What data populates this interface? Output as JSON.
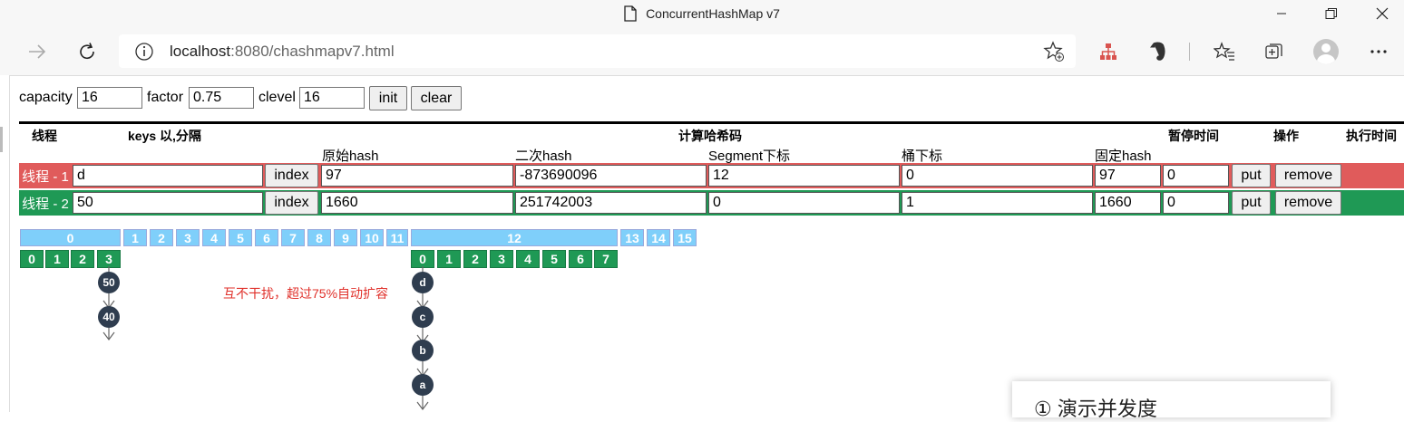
{
  "window": {
    "title": "ConcurrentHashMap v7"
  },
  "address": {
    "host": "localhost",
    "rest": ":8080/chashmapv7.html"
  },
  "form": {
    "capacity_label": "capacity",
    "capacity_value": "16",
    "factor_label": "factor",
    "factor_value": "0.75",
    "clevel_label": "clevel",
    "clevel_value": "16",
    "init_label": "init",
    "clear_label": "clear"
  },
  "table": {
    "headers": {
      "thread": "线程",
      "keys": "keys 以,分隔",
      "compute": "计算哈希码",
      "pause": "暂停时间",
      "ops": "操作",
      "exec": "执行时间"
    },
    "subheaders": {
      "orig_hash": "原始hash",
      "second_hash": "二次hash",
      "segment_index": "Segment下标",
      "bucket_index": "桶下标",
      "fixed_hash": "固定hash"
    },
    "rows": [
      {
        "name": "线程 - 1",
        "keys": "d",
        "index_label": "index",
        "orig_hash": "97",
        "second_hash": "-873690096",
        "segment": "12",
        "bucket": "0",
        "fixed_hash": "97",
        "pause": "0",
        "put_label": "put",
        "remove_label": "remove",
        "color": "#e05b5b"
      },
      {
        "name": "线程 - 2",
        "keys": "50",
        "index_label": "index",
        "orig_hash": "1660",
        "second_hash": "251742003",
        "segment": "0",
        "bucket": "1",
        "fixed_hash": "1660",
        "pause": "0",
        "put_label": "put",
        "remove_label": "remove",
        "color": "#1f9955"
      }
    ]
  },
  "segments": [
    "0",
    "1",
    "2",
    "3",
    "4",
    "5",
    "6",
    "7",
    "8",
    "9",
    "10",
    "11",
    "12",
    "13",
    "14",
    "15"
  ],
  "segment0_buckets": [
    "0",
    "1",
    "2",
    "3"
  ],
  "segment12_buckets": [
    "0",
    "1",
    "2",
    "3",
    "4",
    "5",
    "6",
    "7"
  ],
  "segment0_chain": [
    "50",
    "40"
  ],
  "segment12_chain": [
    "d",
    "c",
    "b",
    "a"
  ],
  "note": "互不干扰，超过75%自动扩容",
  "panel": {
    "title": "①  演示并发度"
  }
}
